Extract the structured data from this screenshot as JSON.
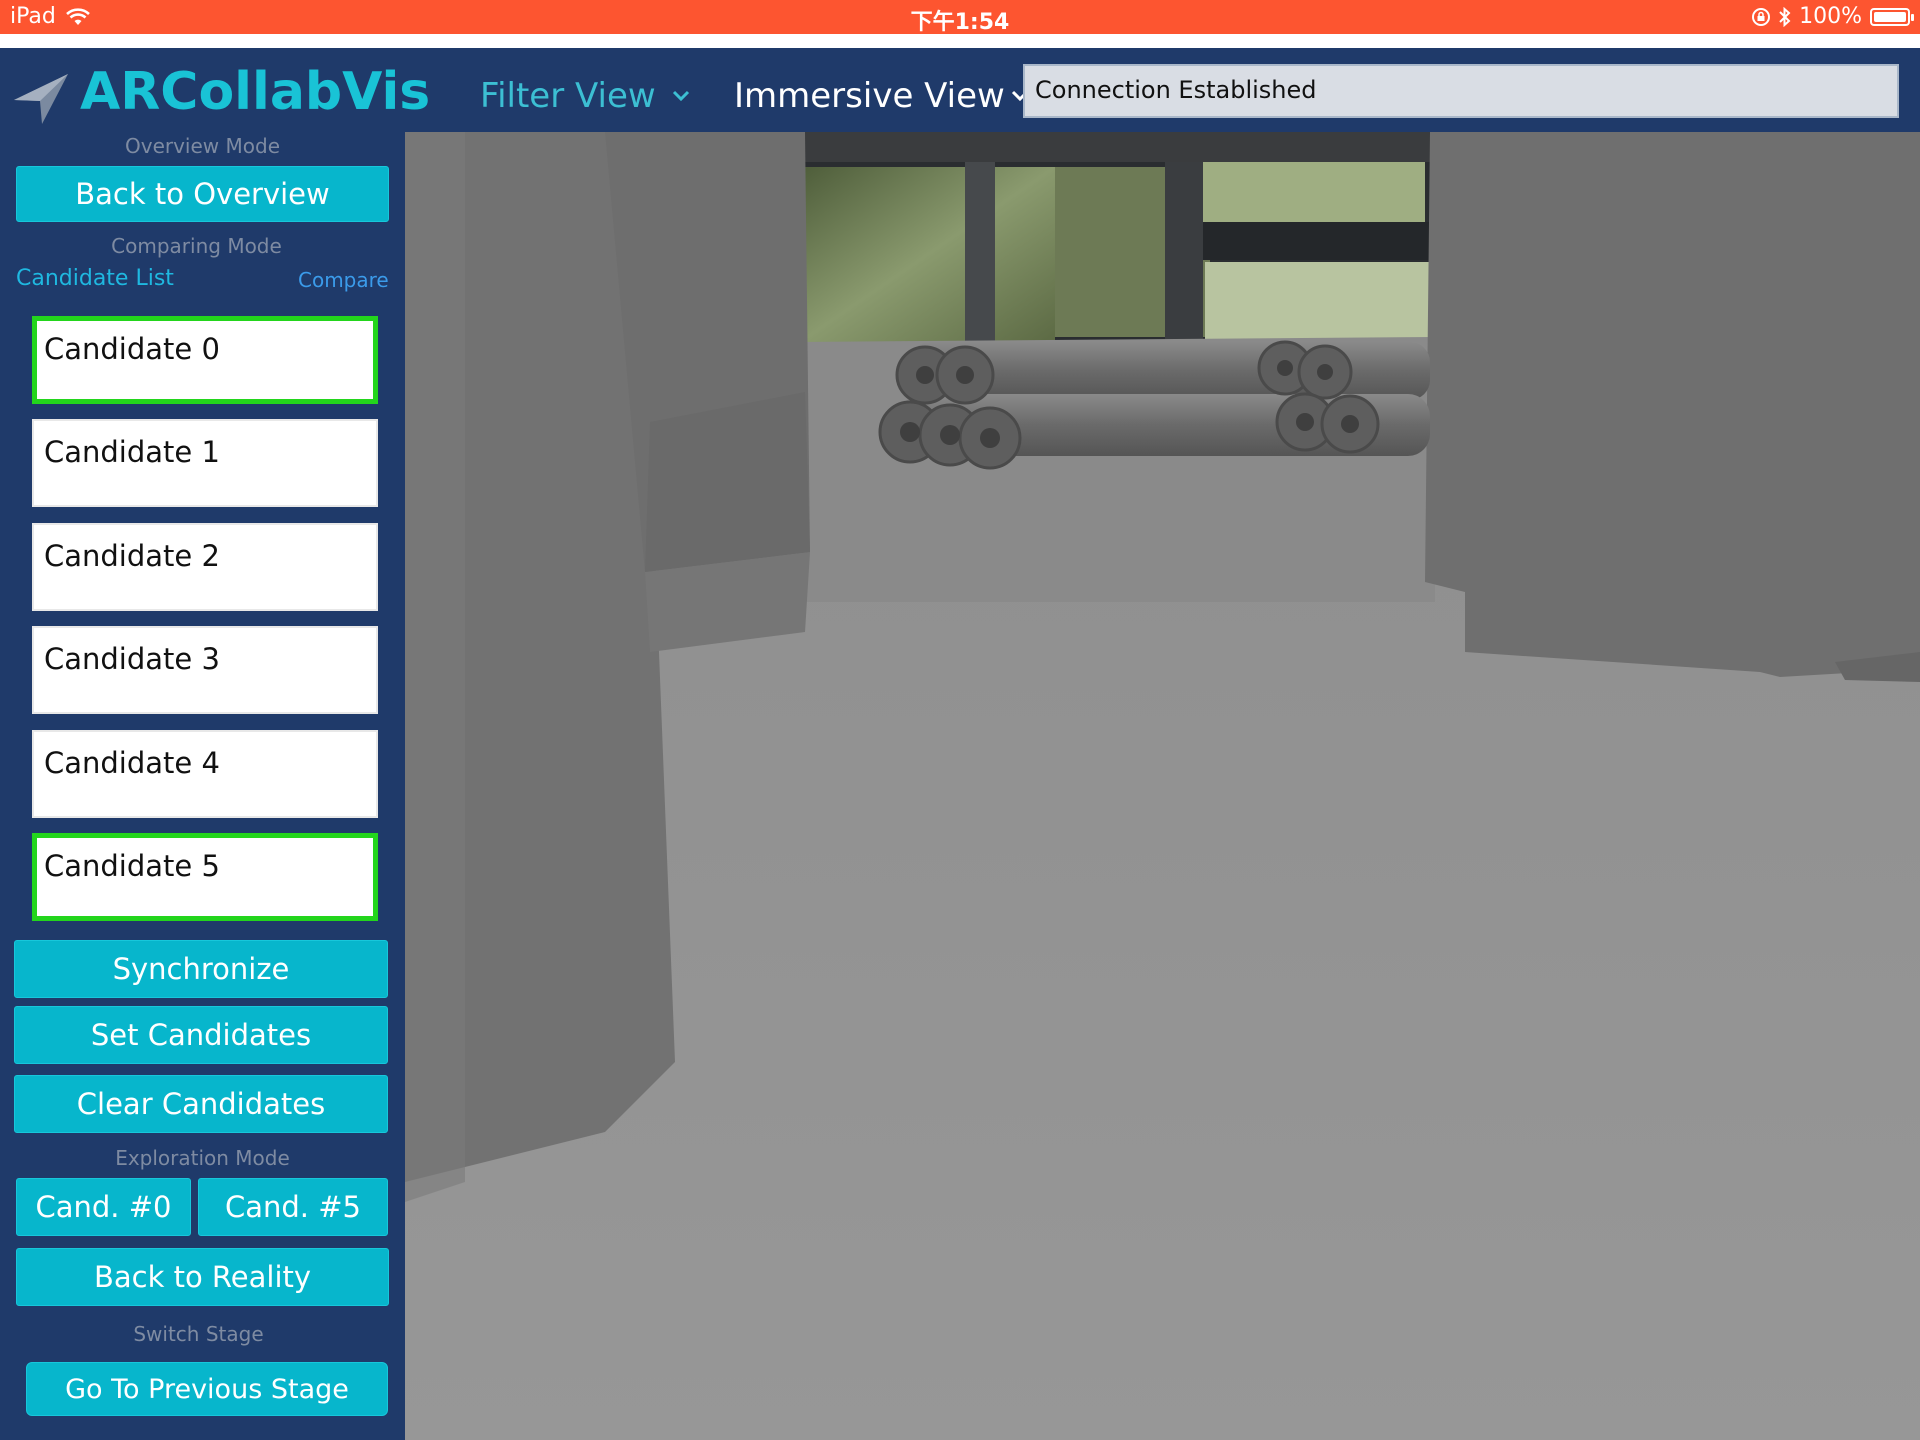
{
  "status_bar": {
    "device": "iPad",
    "time": "下午1:54",
    "battery": "100%"
  },
  "nav": {
    "app_title": "ARCollabVis",
    "filter_view": "Filter View",
    "immersive_view": "Immersive View",
    "connection_status": "Connection Established"
  },
  "sidebar": {
    "overview_mode_label": "Overview Mode",
    "back_to_overview": "Back to Overview",
    "comparing_mode_label": "Comparing Mode",
    "candidate_list_link": "Candidate List",
    "compare_link": "Compare",
    "candidates": [
      {
        "label": "Candidate 0",
        "selected": true
      },
      {
        "label": "Candidate 1",
        "selected": false
      },
      {
        "label": "Candidate 2",
        "selected": false
      },
      {
        "label": "Candidate 3",
        "selected": false
      },
      {
        "label": "Candidate 4",
        "selected": false
      },
      {
        "label": "Candidate 5",
        "selected": true
      }
    ],
    "synchronize": "Synchronize",
    "set_candidates": "Set Candidates",
    "clear_candidates": "Clear Candidates",
    "exploration_mode_label": "Exploration Mode",
    "cand_a": "Cand. #0",
    "cand_b": "Cand. #5",
    "back_to_reality": "Back to Reality",
    "switch_stage_label": "Switch Stage",
    "previous_stage": "Go To Previous Stage"
  },
  "colors": {
    "status_bar": "#fd5530",
    "nav_background": "#1f3a6a",
    "accent": "#07b6cc",
    "selected_border": "#23d51c"
  },
  "icons": [
    "wifi-icon",
    "lock-rotation-icon",
    "bluetooth-icon",
    "battery-icon",
    "location-arrow-icon",
    "chevron-down-icon"
  ]
}
